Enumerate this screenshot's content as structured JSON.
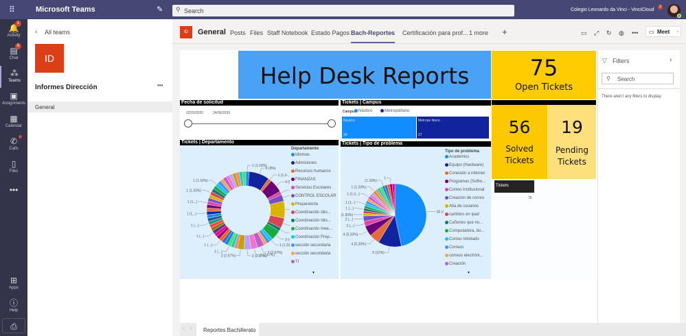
{
  "app": {
    "title": "Microsoft Teams",
    "search_placeholder": "Search",
    "org": "Colegio Leonardo da Vinci - VinciCloud",
    "org_badge": "3"
  },
  "rail": [
    {
      "label": "Activity",
      "icon": "bell-icon",
      "badge": "1"
    },
    {
      "label": "Chat",
      "icon": "chat-icon",
      "badge": "6"
    },
    {
      "label": "Teams",
      "icon": "teams-icon",
      "active": true
    },
    {
      "label": "Assignments",
      "icon": "assignments-icon"
    },
    {
      "label": "Calendar",
      "icon": "calendar-icon"
    },
    {
      "label": "Calls",
      "icon": "phone-icon"
    },
    {
      "label": "Files",
      "icon": "file-icon"
    }
  ],
  "rail_bottom": {
    "more": "•••",
    "apps": "Apps",
    "help": "Help"
  },
  "team": {
    "back": "All teams",
    "avatar": "ID",
    "name": "Informes Dirección",
    "more": "•••",
    "channel": "General"
  },
  "channel": {
    "avatar": "ID",
    "name": "General",
    "tabs": [
      "Posts",
      "Files",
      "Staff Notebook",
      "Estado Pagos",
      "Bach-Reportes",
      "Certificación para prof...",
      "1 more"
    ],
    "active_tab": "Bach-Reportes",
    "meet": "Meet"
  },
  "report": {
    "title": "Help Desk Reports",
    "open": {
      "value": "75",
      "label": "Open Tickets"
    },
    "solved": {
      "value": "56",
      "label1": "Solved",
      "label2": "Tickets"
    },
    "pending": {
      "value": "19",
      "label1": "Pending",
      "label2": "Tickets"
    },
    "tickets_card": {
      "label": "Tickets",
      "value": "75"
    },
    "slicer": {
      "title": "Fecha de solicitud",
      "from": "02/03/2020",
      "to": "24/06/2020"
    },
    "campus": {
      "title": "Tickets | Campus",
      "legend_title": "Campus",
      "items": [
        {
          "name": "Náutico",
          "value": 38,
          "color": "#118dff",
          "label": "Náutico",
          "vlabel": "38"
        },
        {
          "name": "Metropolitano",
          "value": 37,
          "color": "#12239e",
          "label": "Metropo litano",
          "vlabel": "37"
        }
      ]
    }
  },
  "chart_data": [
    {
      "type": "pie",
      "variant": "donut",
      "title": "Tickets | Departamento",
      "legend_title": "Departamento",
      "legend": [
        "Idiomas",
        "Admisiones",
        "Recursos humanos",
        "FINANZAS",
        "Servicios Escolares",
        "CONTROL ESCOLAR",
        "Preparatoria",
        "Coordinación Idio...",
        "Coordinación Idio...",
        "Coordinación Inee...",
        "Coordinación Prep...",
        "sección secundaria",
        "sección secundaria",
        "TI"
      ],
      "values": [
        1,
        6,
        1,
        4,
        1,
        2,
        5,
        3,
        1,
        3,
        1,
        1,
        1,
        2,
        2,
        2,
        2,
        1,
        1,
        1,
        1,
        1,
        1,
        1,
        1,
        1,
        1,
        1,
        1,
        1,
        1,
        1,
        1,
        1,
        1,
        1,
        1,
        1,
        1,
        1,
        1,
        1,
        1,
        1,
        1,
        1,
        1,
        1,
        1,
        1
      ],
      "labels": {
        "0": "1 (1.33%)",
        "1": "6 (8%)",
        "2": "1 (1.3...)",
        "3": "4 (5.33%)",
        "4": "1 (...)",
        "5": "2 (...)",
        "6": "5 (6.67%)",
        "7": "3 (4%)",
        "8": "1 (1.3...)",
        "9": "3 (4%)",
        "10": "1 (1.33%)",
        "13": "2 (2.67%)",
        "14": "2 (2.67%)",
        "15": "2 (2.67%)",
        "16": "2 (2.57%)",
        "19": "1 (...)",
        "22": "1 (...)",
        "25": "1 (...)",
        "28": "1 (...)",
        "31": "1 (1...)",
        "34": "1 (1...)",
        "37": "1 (1.33%)",
        "40": "1 (1.33%)"
      }
    },
    {
      "type": "pie",
      "title": "Tickets | Tipo de problema",
      "legend_title": "Tipo de problema",
      "legend": [
        "Academics",
        "Equipo (Hardware)",
        "Conexión a internet",
        "Programas (Softw...",
        "Correo institucional",
        "Creación de correo",
        "Alta de usuarios",
        "cambios en ipad",
        "Cañones que no...",
        "Computadora, bo...",
        "Correo rebotado",
        "Correos",
        "correos electróni...",
        "Creación"
      ],
      "values": [
        35,
        9,
        4,
        4,
        2,
        2,
        1,
        1,
        1,
        1,
        1,
        1,
        1,
        1,
        1,
        1,
        1,
        1,
        1,
        1,
        1,
        1,
        1,
        1,
        1
      ],
      "labels": {
        "0": "35 (46.67%)",
        "1": "9 (12%)",
        "2": "4 (5.33%)",
        "3": "4 (5.33%)",
        "4": "2 (...)",
        "5": "2 (...)",
        "6": "1 (1.33%)",
        "8": "1 (...)",
        "10": "1 (1...)",
        "13": "1 (1.3...)",
        "16": "1 (1.33%)",
        "20": "(1.33%)",
        "23": "1"
      }
    }
  ],
  "palette": [
    "#118dff",
    "#12239e",
    "#e66c37",
    "#6b007b",
    "#e044a7",
    "#744ec2",
    "#d9b300",
    "#d64550",
    "#197278",
    "#1aab40",
    "#15c6f4",
    "#4092ff",
    "#ffa058",
    "#be5dc9",
    "#f472d0",
    "#b5a1ff",
    "#c4a200",
    "#ff8080",
    "#00dbbc",
    "#5bd667",
    "#0091d5",
    "#4668c5",
    "#ff6300",
    "#99008a",
    "#ec008c",
    "#533285",
    "#99700a",
    "#ff4141",
    "#1f9a85",
    "#255a8f"
  ],
  "filters": {
    "title": "Filters",
    "search": "Search",
    "empty": "There aren't any filters to display."
  },
  "bottom": {
    "page_tab": "Reportes Bachillerato"
  }
}
